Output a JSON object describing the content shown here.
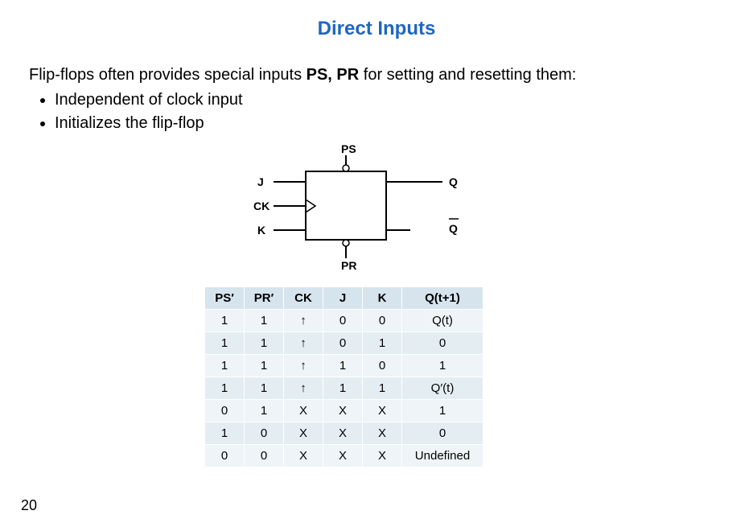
{
  "title": "Direct Inputs",
  "lead_pre": "Flip-flops often provides special inputs ",
  "lead_strong": "PS, PR",
  "lead_post": " for setting and resetting them:",
  "bullets": [
    "Independent of clock input",
    "Initializes the flip-flop"
  ],
  "diagram": {
    "ps": "PS",
    "pr": "PR",
    "j": "J",
    "ck": "CK",
    "k": "K",
    "q": "Q",
    "qbar": "Q"
  },
  "table": {
    "headers": [
      "PS′",
      "PR′",
      "CK",
      "J",
      "K",
      "Q(t+1)"
    ],
    "rows": [
      [
        "1",
        "1",
        "↑",
        "0",
        "0",
        "Q(t)"
      ],
      [
        "1",
        "1",
        "↑",
        "0",
        "1",
        "0"
      ],
      [
        "1",
        "1",
        "↑",
        "1",
        "0",
        "1"
      ],
      [
        "1",
        "1",
        "↑",
        "1",
        "1",
        "Q′(t)"
      ],
      [
        "0",
        "1",
        "X",
        "X",
        "X",
        "1"
      ],
      [
        "1",
        "0",
        "X",
        "X",
        "X",
        "0"
      ],
      [
        "0",
        "0",
        "X",
        "X",
        "X",
        "Undefined"
      ]
    ]
  },
  "page_number": "20"
}
